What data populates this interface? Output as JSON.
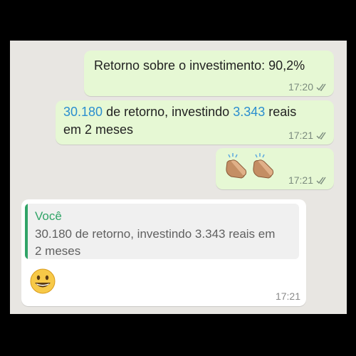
{
  "messages": [
    {
      "text": "Retorno sobre o investimento: 90,2%",
      "time": "17:20",
      "status": "read"
    },
    {
      "highlight_1": "30.180",
      "text_1": " de retorno, investindo ",
      "highlight_2": "3.343",
      "text_2": " reais",
      "text_line2": "em 2 meses",
      "time": "17:21",
      "status": "read"
    },
    {
      "emoji": "clapping-hands-icon x2",
      "time": "17:21",
      "status": "read"
    }
  ],
  "reply": {
    "quoted_author": "Você",
    "quoted_line1": "30.180 de retorno, investindo 3.343 reais em",
    "quoted_line2": "2 meses",
    "emoji": "grinning-face-icon",
    "time": "17:21"
  },
  "colors": {
    "chat_background": "#e8e6e2",
    "outgoing_bubble": "#e6f8d4",
    "incoming_bubble": "#ffffff",
    "number_link": "#2a8ecf",
    "quote_accent": "#30a467",
    "read_ticks": "#7b8b7e"
  }
}
